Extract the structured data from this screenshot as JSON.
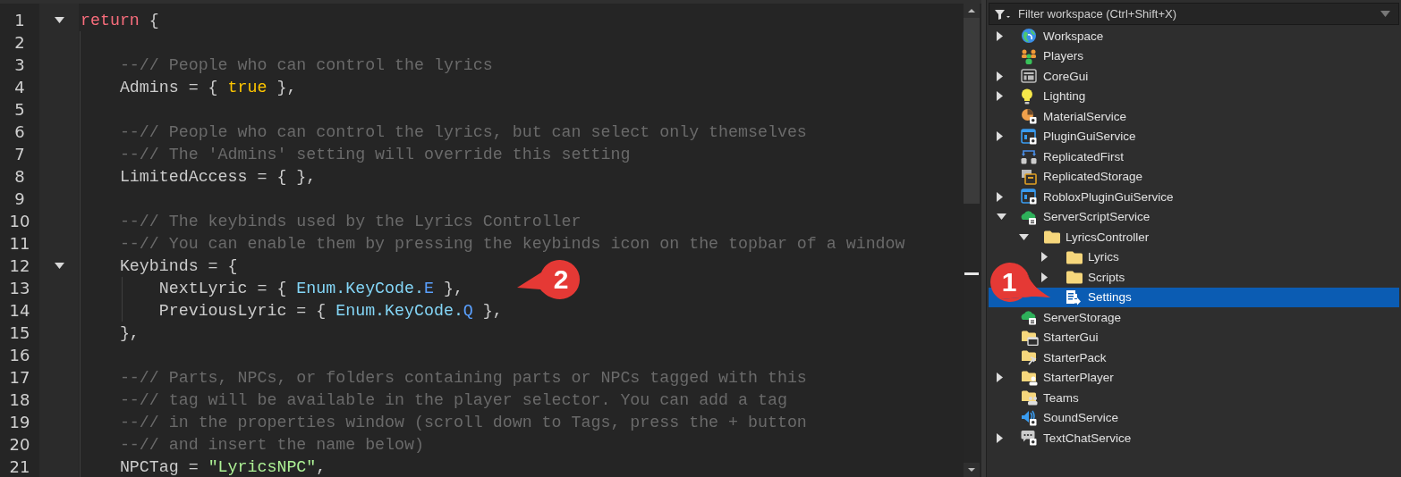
{
  "editor": {
    "lines": [
      {
        "number": "1",
        "foldable": true,
        "tokens": [
          {
            "kind": "keyword",
            "text": "return"
          },
          {
            "kind": "plain",
            "text": " {"
          }
        ]
      },
      {
        "number": "2",
        "foldable": false
      },
      {
        "number": "3",
        "foldable": false,
        "tokens": [
          {
            "kind": "comment",
            "text": "    --// People who can control the lyrics"
          }
        ]
      },
      {
        "number": "4",
        "foldable": false,
        "tokens": [
          {
            "kind": "plain",
            "text": "    Admins = { "
          },
          {
            "kind": "bool",
            "text": "true"
          },
          {
            "kind": "plain",
            "text": " },"
          }
        ]
      },
      {
        "number": "5",
        "foldable": false
      },
      {
        "number": "6",
        "foldable": false,
        "tokens": [
          {
            "kind": "comment",
            "text": "    --// People who can control the lyrics, but can select only themselves"
          }
        ]
      },
      {
        "number": "7",
        "foldable": false,
        "tokens": [
          {
            "kind": "comment",
            "text": "    --// The 'Admins' setting will override this setting"
          }
        ]
      },
      {
        "number": "8",
        "foldable": false,
        "tokens": [
          {
            "kind": "plain",
            "text": "    LimitedAccess = { },"
          }
        ]
      },
      {
        "number": "9",
        "foldable": false
      },
      {
        "number": "10",
        "foldable": false,
        "tokens": [
          {
            "kind": "comment",
            "text": "    --// The keybinds used by the Lyrics Controller"
          }
        ]
      },
      {
        "number": "11",
        "foldable": false,
        "tokens": [
          {
            "kind": "comment",
            "text": "    --// You can enable them by pressing the keybinds icon on the topbar of a window"
          }
        ]
      },
      {
        "number": "12",
        "foldable": true,
        "tokens": [
          {
            "kind": "plain",
            "text": "    Keybinds = {"
          }
        ]
      },
      {
        "number": "13",
        "foldable": false,
        "tokens": [
          {
            "kind": "plain",
            "text": "        NextLyric = { "
          },
          {
            "kind": "enum",
            "text": "Enum.KeyCode."
          },
          {
            "kind": "member",
            "text": "E"
          },
          {
            "kind": "plain",
            "text": " },"
          }
        ]
      },
      {
        "number": "14",
        "foldable": false,
        "tokens": [
          {
            "kind": "plain",
            "text": "        PreviousLyric = { "
          },
          {
            "kind": "enum",
            "text": "Enum.KeyCode."
          },
          {
            "kind": "member",
            "text": "Q"
          },
          {
            "kind": "plain",
            "text": " },"
          }
        ]
      },
      {
        "number": "15",
        "foldable": false,
        "tokens": [
          {
            "kind": "plain",
            "text": "    },"
          }
        ]
      },
      {
        "number": "16",
        "foldable": false
      },
      {
        "number": "17",
        "foldable": false,
        "tokens": [
          {
            "kind": "comment",
            "text": "    --// Parts, NPCs, or folders containing parts or NPCs tagged with this"
          }
        ]
      },
      {
        "number": "18",
        "foldable": false,
        "tokens": [
          {
            "kind": "comment",
            "text": "    --// tag will be available in the player selector. You can add a tag"
          }
        ]
      },
      {
        "number": "19",
        "foldable": false,
        "tokens": [
          {
            "kind": "comment",
            "text": "    --// in the properties window (scroll down to Tags, press the + button"
          }
        ]
      },
      {
        "number": "20",
        "foldable": false,
        "tokens": [
          {
            "kind": "comment",
            "text": "    --// and insert the name below)"
          }
        ]
      },
      {
        "number": "21",
        "foldable": false,
        "tokens": [
          {
            "kind": "plain",
            "text": "    NPCTag = "
          },
          {
            "kind": "string",
            "text": "\"LyricsNPC\""
          },
          {
            "kind": "plain",
            "text": ","
          }
        ]
      }
    ]
  },
  "explorer": {
    "filter": {
      "placeholder": "Filter workspace (Ctrl+Shift+X)"
    },
    "items": [
      {
        "label": "Workspace",
        "kind": "workspace",
        "expanded": false,
        "selected": false
      },
      {
        "label": "Players",
        "kind": "players",
        "selected": false
      },
      {
        "label": "CoreGui",
        "kind": "coregui",
        "expanded": false,
        "selected": false
      },
      {
        "label": "Lighting",
        "kind": "lighting",
        "expanded": false,
        "selected": false
      },
      {
        "label": "MaterialService",
        "kind": "material",
        "selected": false
      },
      {
        "label": "PluginGuiService",
        "kind": "plugingui",
        "expanded": false,
        "selected": false
      },
      {
        "label": "ReplicatedFirst",
        "kind": "replicatedfirst",
        "selected": false
      },
      {
        "label": "ReplicatedStorage",
        "kind": "replicatedstorage",
        "selected": false
      },
      {
        "label": "RobloxPluginGuiService",
        "kind": "robloxplugingui",
        "expanded": false,
        "selected": false
      },
      {
        "label": "ServerScriptService",
        "kind": "serverscript",
        "expanded": true,
        "selected": false,
        "children": [
          {
            "label": "LyricsController",
            "kind": "folder",
            "expanded": true,
            "selected": false,
            "children": [
              {
                "label": "Lyrics",
                "kind": "folder",
                "expanded": false,
                "selected": false
              },
              {
                "label": "Scripts",
                "kind": "folder",
                "expanded": false,
                "selected": false
              },
              {
                "label": "Settings",
                "kind": "modulescript",
                "selected": true
              }
            ]
          }
        ]
      },
      {
        "label": "ServerStorage",
        "kind": "serverstorage",
        "selected": false
      },
      {
        "label": "StarterGui",
        "kind": "startergui",
        "selected": false
      },
      {
        "label": "StarterPack",
        "kind": "starterpack",
        "selected": false
      },
      {
        "label": "StarterPlayer",
        "kind": "starterplayer",
        "expanded": false,
        "selected": false
      },
      {
        "label": "Teams",
        "kind": "teams",
        "selected": false
      },
      {
        "label": "SoundService",
        "kind": "sound",
        "selected": false
      },
      {
        "label": "TextChatService",
        "kind": "textchat",
        "expanded": false,
        "selected": false
      }
    ]
  },
  "callouts": [
    {
      "text": "2"
    },
    {
      "text": "1"
    }
  ]
}
